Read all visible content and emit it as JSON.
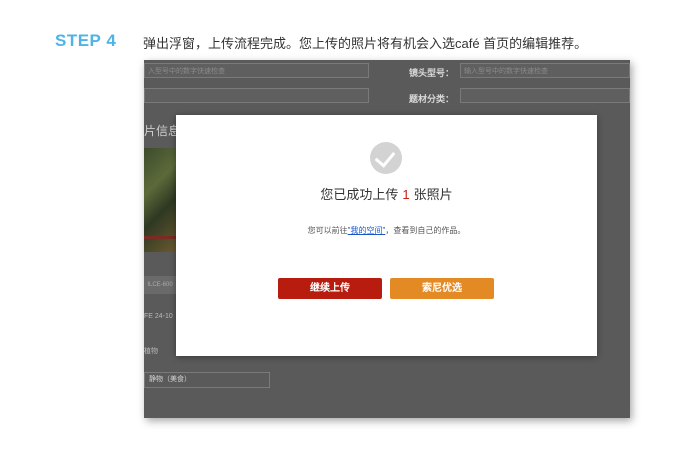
{
  "step": {
    "label": "STEP 4",
    "description": "弹出浮窗，上传流程完成。您上传的照片将有机会入选café 首页的编辑推荐。"
  },
  "background_form": {
    "input1_placeholder": "入型号中的数字快速检查",
    "lens_label": "镜头型号：",
    "lens_placeholder": "输入型号中的数字快速检查",
    "category_label": "题材分类：",
    "photo_info_heading": "照片信息",
    "camera_button": "ILCE-600",
    "lens_info": "FE 24-10",
    "tag_text": "植物",
    "category_field": "静物（美食）"
  },
  "modal": {
    "title_prefix": "您已成功上传",
    "count": "1",
    "title_suffix": "张照片",
    "sub_prefix": "您可以前往",
    "sub_link": "\"我的空间\"",
    "sub_suffix": "，查看到自己的作品。",
    "continue_button": "继续上传",
    "sony_button": "索尼优选"
  },
  "colors": {
    "step_accent": "#4fb3e8",
    "continue_button": "#b81c0f",
    "sony_button": "#e38a25",
    "count_highlight": "#c81e14"
  }
}
